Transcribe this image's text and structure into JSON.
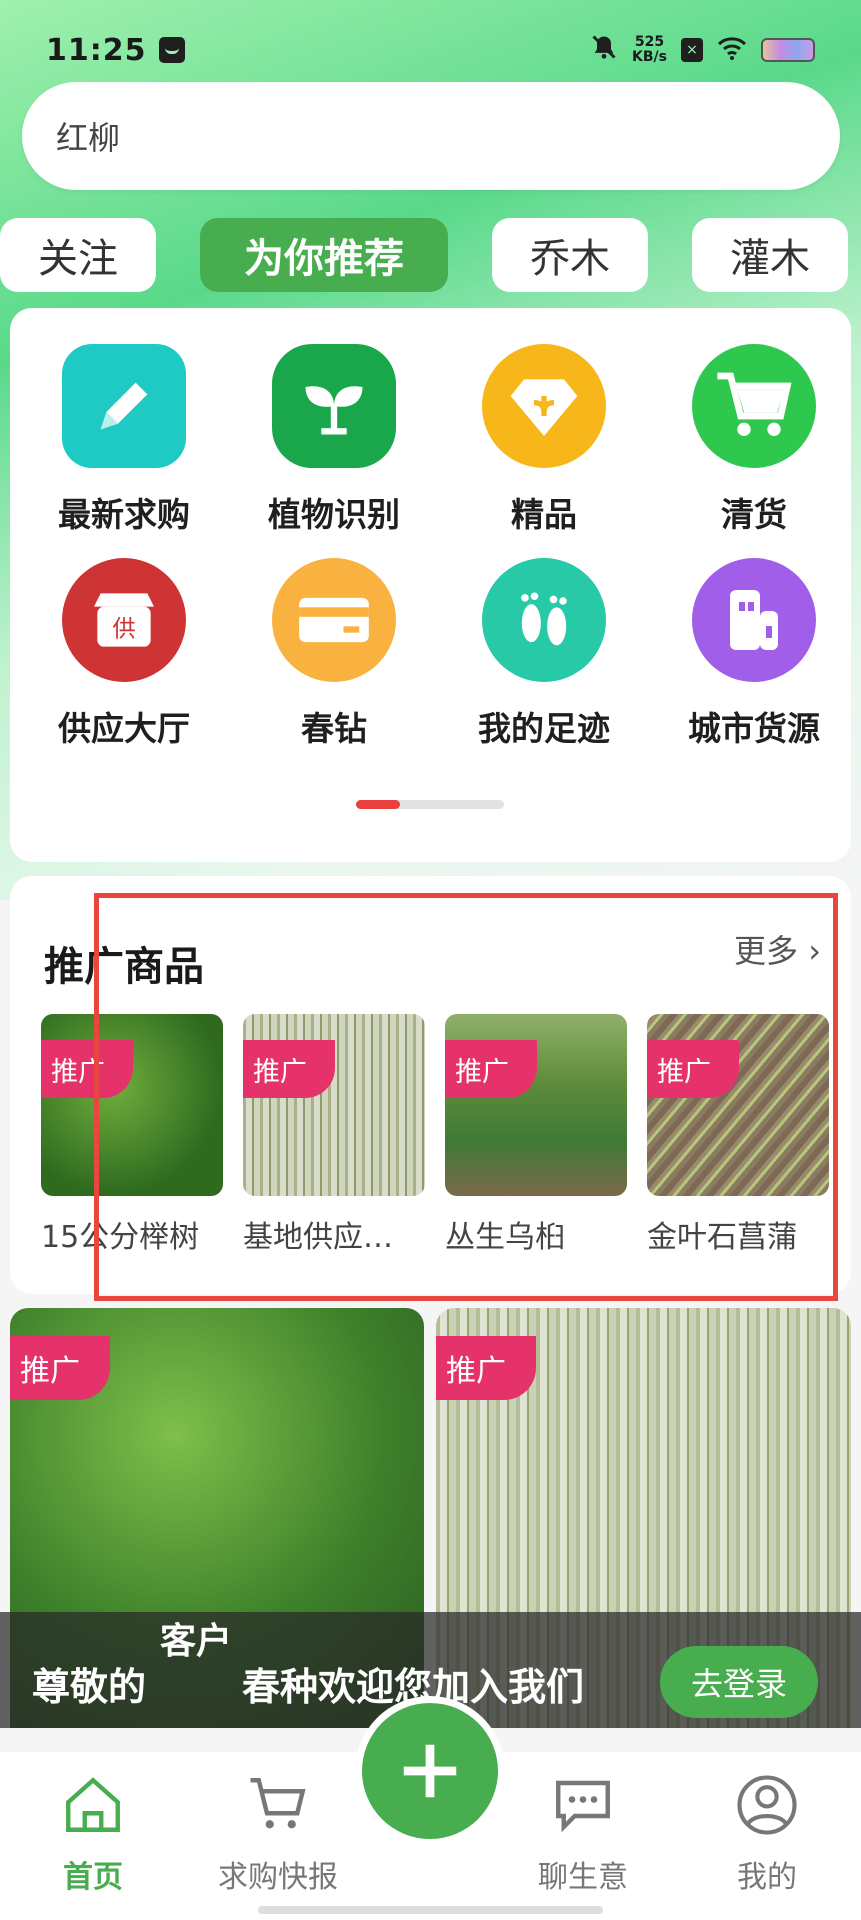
{
  "status_bar": {
    "time": "11:25",
    "speed_value": "525",
    "speed_unit": "KB/s"
  },
  "search": {
    "value": "红柳"
  },
  "tabs": [
    {
      "label": "关注",
      "active": false
    },
    {
      "label": "为你推荐",
      "active": true
    },
    {
      "label": "乔木",
      "active": false
    },
    {
      "label": "灌木",
      "active": false
    }
  ],
  "grid": {
    "items": [
      {
        "label": "最新求购",
        "icon": "pencil-icon",
        "color": "#1fc9c4"
      },
      {
        "label": "植物识别",
        "icon": "sprout-icon",
        "color": "#1aa64a"
      },
      {
        "label": "精品",
        "icon": "diamond-icon",
        "color": "#f7b61a"
      },
      {
        "label": "清货",
        "icon": "cart-icon",
        "color": "#2fc84f"
      },
      {
        "label": "供应大厅",
        "icon": "supply-store-icon",
        "color": "#cf3434",
        "badge": "供"
      },
      {
        "label": "春钻",
        "icon": "card-icon",
        "color": "#f9b240"
      },
      {
        "label": "我的足迹",
        "icon": "footprint-icon",
        "color": "#27c9a6"
      },
      {
        "label": "城市货源",
        "icon": "building-icon",
        "color": "#a15ee8"
      }
    ],
    "page": {
      "current": 1,
      "total": 3
    }
  },
  "promo": {
    "title": "推广商品",
    "more": "更多",
    "tag": "推广",
    "items": [
      {
        "name": "15公分榉树"
      },
      {
        "name": "基地供应…"
      },
      {
        "name": "丛生乌桕"
      },
      {
        "name": "金叶石菖蒲"
      }
    ]
  },
  "feed": {
    "tag": "推广"
  },
  "login_banner": {
    "dear": "尊敬的",
    "customer": "客户",
    "welcome": "春种欢迎您加入我们",
    "button": "去登录"
  },
  "nav": [
    {
      "label": "首页",
      "icon": "home-icon",
      "active": true
    },
    {
      "label": "求购快报",
      "icon": "cart-icon",
      "active": false
    },
    {
      "label": "聊生意",
      "icon": "chat-icon",
      "active": false
    },
    {
      "label": "我的",
      "icon": "user-icon",
      "active": false
    }
  ],
  "colors": {
    "brand_green": "#47ad4e",
    "promo_pink": "#e6326b",
    "highlight_red": "#e8473f"
  }
}
